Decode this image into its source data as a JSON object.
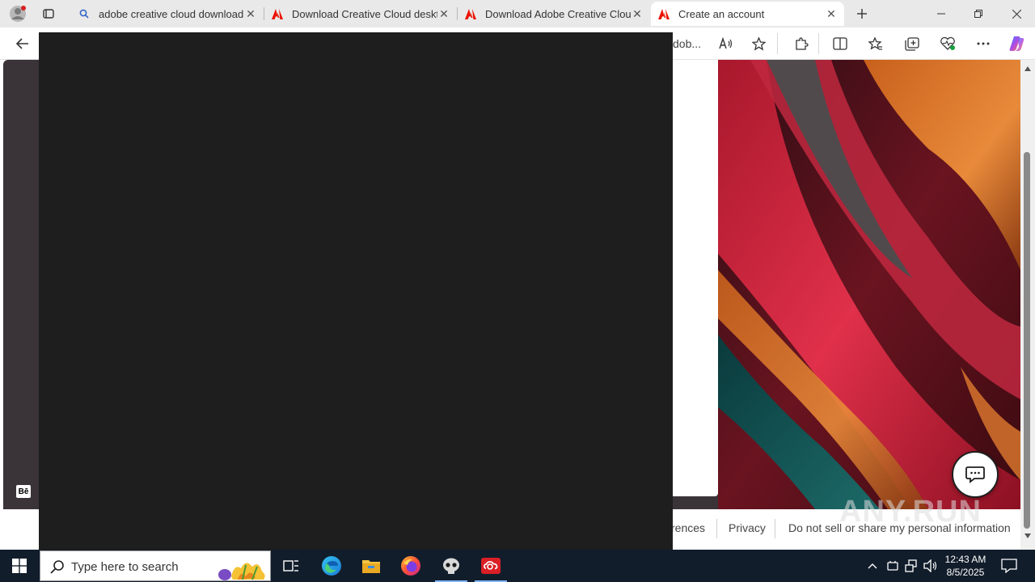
{
  "browser": {
    "tabs": [
      {
        "title": "adobe creative cloud download -",
        "favicon": "search-icon"
      },
      {
        "title": "Download Creative Cloud desktop",
        "favicon": "adobe-icon"
      },
      {
        "title": "Download Adobe Creative Cloud",
        "favicon": "adobe-icon"
      },
      {
        "title": "Create an account",
        "favicon": "adobe-icon",
        "active": true
      }
    ],
    "address_visible_text": "dob..."
  },
  "page": {
    "footer_links": [
      "rences",
      "Privacy",
      "Do not sell or share my personal information"
    ],
    "behance_glyph": "Bē",
    "watermark": "ANY.RUN"
  },
  "taskbar": {
    "search_placeholder": "Type here to search",
    "time": "12:43 AM",
    "date": "8/5/2025"
  },
  "colors": {
    "overlay": "#1e1e1e",
    "page_dark_panel": "#3a3337",
    "taskbar": "#121d2b",
    "adobe_red": "#eb1000"
  }
}
